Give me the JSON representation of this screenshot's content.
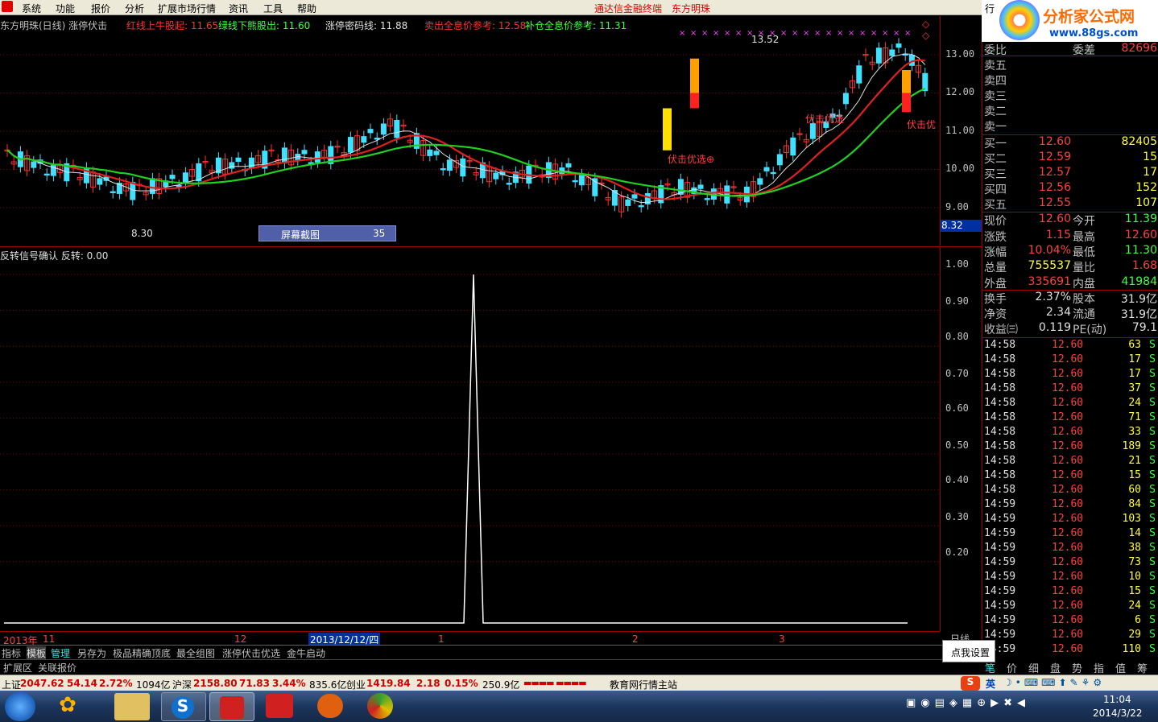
{
  "menu": [
    "系统",
    "功能",
    "报价",
    "分析",
    "扩展市场行情",
    "资讯",
    "工具",
    "帮助"
  ],
  "menu_brand": [
    "通达信金融终端",
    "东方明珠"
  ],
  "corner_brand": {
    "title": "分析家公式网",
    "url": "www.88gs.com",
    "tab": "行"
  },
  "chart_header": {
    "name": "东方明珠(日线) 涨停伏击",
    "items": [
      {
        "text": "红线上牛股起: 11.65",
        "color": "#ff3030"
      },
      {
        "text": "绿线下熊股出: 11.60",
        "color": "#40ff40"
      },
      {
        "text": "涨停密码线: 11.88",
        "color": "#e0e0e0"
      },
      {
        "text": "卖出全息价参考: 12.58",
        "color": "#ff3030"
      },
      {
        "text": "补仓全息价参考: 11.31",
        "color": "#40ff40"
      }
    ]
  },
  "price_axis": [
    "13.00",
    "12.00",
    "11.00",
    "10.00",
    "9.00"
  ],
  "price_marker": "8.32",
  "chart_labels": {
    "high": "13.52",
    "low": "8.30",
    "signal1": "伏击优选⊕",
    "signal2": "伏击优选",
    "signal3": "伏击优"
  },
  "screenshot_box": {
    "label": "屏幕截图",
    "value": "35"
  },
  "indicator_header": "反转信号确认  反转: 0.00",
  "ind_axis": [
    "1.00",
    "0.90",
    "0.80",
    "0.70",
    "0.60",
    "0.50",
    "0.40",
    "0.30",
    "0.20"
  ],
  "time_axis": {
    "year": "2013年",
    "m11": "11",
    "m12": "12",
    "cursor": "2013/12/12/四",
    "m1": "1",
    "m2": "2",
    "m3": "3"
  },
  "tabs": [
    "指标",
    "模板",
    "管理",
    "另存为",
    "极品精确顶底",
    "最全组图",
    "涨停伏击优选",
    "金牛启动"
  ],
  "tabs2": [
    "扩展区",
    "关联报价"
  ],
  "right_label_daily": "日线",
  "tooltip": "点我设置",
  "order_book": {
    "weibi_label": "委比",
    "weibi_v": "",
    "weicha_label": "委差",
    "weicha_v": "82696",
    "sells": [
      {
        "l": "卖五"
      },
      {
        "l": "卖四"
      },
      {
        "l": "卖三"
      },
      {
        "l": "卖二"
      },
      {
        "l": "卖一"
      }
    ],
    "buys": [
      {
        "l": "买一",
        "p": "12.60",
        "v": "82405"
      },
      {
        "l": "买二",
        "p": "12.59",
        "v": "15"
      },
      {
        "l": "买三",
        "p": "12.57",
        "v": "17"
      },
      {
        "l": "买四",
        "p": "12.56",
        "v": "152"
      },
      {
        "l": "买五",
        "p": "12.55",
        "v": "107"
      }
    ]
  },
  "quote": [
    {
      "l1": "现价",
      "v1": "12.60",
      "c1": "red",
      "l2": "今开",
      "v2": "11.39",
      "c2": "green"
    },
    {
      "l1": "涨跌",
      "v1": "1.15",
      "c1": "red",
      "l2": "最高",
      "v2": "12.60",
      "c2": "red"
    },
    {
      "l1": "涨幅",
      "v1": "10.04%",
      "c1": "red",
      "l2": "最低",
      "v2": "11.30",
      "c2": "green"
    },
    {
      "l1": "总量",
      "v1": "755537",
      "c1": "yel",
      "l2": "量比",
      "v2": "1.68",
      "c2": "red"
    },
    {
      "l1": "外盘",
      "v1": "335691",
      "c1": "red",
      "l2": "内盘",
      "v2": "41984",
      "c2": "green"
    },
    {
      "l1": "换手",
      "v1": "2.37%",
      "c1": "wht",
      "l2": "股本",
      "v2": "31.9亿",
      "c2": "wht"
    },
    {
      "l1": "净资",
      "v1": "2.34",
      "c1": "wht",
      "l2": "流通",
      "v2": "31.9亿",
      "c2": "wht"
    },
    {
      "l1": "收益㈢",
      "v1": "0.119",
      "c1": "wht",
      "l2": "PE(动)",
      "v2": "79.1",
      "c2": "wht"
    }
  ],
  "trades": [
    {
      "t": "14:58",
      "p": "12.60",
      "v": "63",
      "s": "S"
    },
    {
      "t": "14:58",
      "p": "12.60",
      "v": "17",
      "s": "S"
    },
    {
      "t": "14:58",
      "p": "12.60",
      "v": "17",
      "s": "S"
    },
    {
      "t": "14:58",
      "p": "12.60",
      "v": "37",
      "s": "S"
    },
    {
      "t": "14:58",
      "p": "12.60",
      "v": "24",
      "s": "S"
    },
    {
      "t": "14:58",
      "p": "12.60",
      "v": "71",
      "s": "S"
    },
    {
      "t": "14:58",
      "p": "12.60",
      "v": "33",
      "s": "S"
    },
    {
      "t": "14:58",
      "p": "12.60",
      "v": "189",
      "s": "S"
    },
    {
      "t": "14:58",
      "p": "12.60",
      "v": "21",
      "s": "S"
    },
    {
      "t": "14:58",
      "p": "12.60",
      "v": "15",
      "s": "S"
    },
    {
      "t": "14:58",
      "p": "12.60",
      "v": "60",
      "s": "S"
    },
    {
      "t": "14:59",
      "p": "12.60",
      "v": "84",
      "s": "S"
    },
    {
      "t": "14:59",
      "p": "12.60",
      "v": "103",
      "s": "S"
    },
    {
      "t": "14:59",
      "p": "12.60",
      "v": "14",
      "s": "S"
    },
    {
      "t": "14:59",
      "p": "12.60",
      "v": "38",
      "s": "S"
    },
    {
      "t": "14:59",
      "p": "12.60",
      "v": "73",
      "s": "S"
    },
    {
      "t": "14:59",
      "p": "12.60",
      "v": "10",
      "s": "S"
    },
    {
      "t": "14:59",
      "p": "12.60",
      "v": "15",
      "s": "S"
    },
    {
      "t": "14:59",
      "p": "12.60",
      "v": "24",
      "s": "S"
    },
    {
      "t": "14:59",
      "p": "12.60",
      "v": "6",
      "s": "S"
    },
    {
      "t": "14:59",
      "p": "12.60",
      "v": "29",
      "s": "S"
    },
    {
      "t": "14:59",
      "p": "12.60",
      "v": "110",
      "s": "S"
    }
  ],
  "right_tabs": [
    "笔",
    "价",
    "细",
    "盘",
    "势",
    "指",
    "值",
    "筹"
  ],
  "status": {
    "sh_label": "上证",
    "sh": "2047.62",
    "sh_chg": "54.14",
    "sh_pct": "2.72%",
    "sh_amt": "1094亿",
    "hs_label": "沪深",
    "hs": "2158.80",
    "hs_chg": "71.83",
    "hs_pct": "3.44%",
    "hs_amt": "835.6亿",
    "cy_label": "创业",
    "cy": "1419.84",
    "cy_chg": "2.18",
    "cy_pct": "0.15%",
    "cy_amt": "250.9亿",
    "news": "教育网行情主站"
  },
  "clock": {
    "time": "11:04",
    "date": "2014/3/22"
  },
  "ime": "英",
  "indicator_signal": {
    "x_index": 96,
    "value": 1.0
  }
}
